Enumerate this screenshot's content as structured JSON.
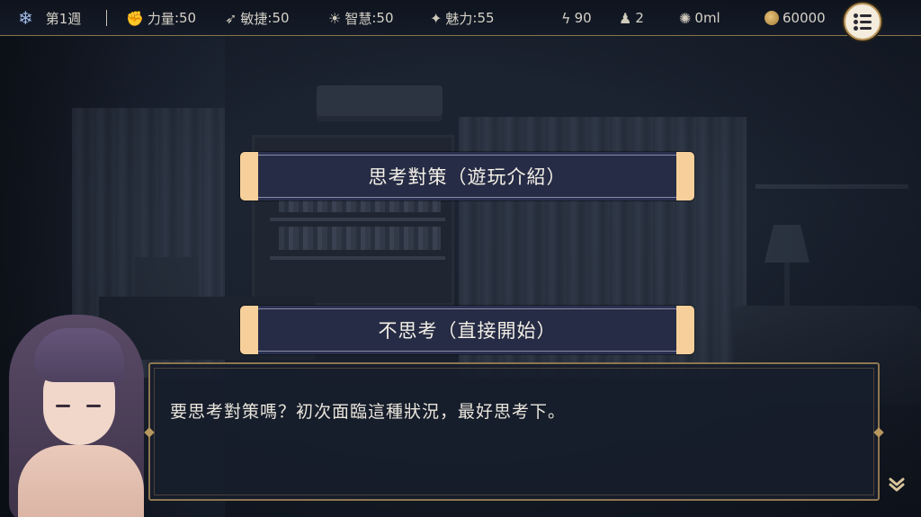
{
  "hud": {
    "week": "第1週",
    "stats": [
      {
        "name": "力量",
        "value": ":50",
        "icon": "fist-icon"
      },
      {
        "name": "敏捷",
        "value": ":50",
        "icon": "wing-icon"
      },
      {
        "name": "智慧",
        "value": ":50",
        "icon": "lightbulb-icon"
      },
      {
        "name": "魅力",
        "value": ":55",
        "icon": "sparkle-icon"
      }
    ],
    "energy": "90",
    "people": "2",
    "liquid": "0ml",
    "money": "60000"
  },
  "choices": [
    {
      "label": "思考對策（遊玩介紹）"
    },
    {
      "label": "不思考（直接開始）"
    }
  ],
  "dialog": {
    "text": "要思考對策嗎？初次面臨這種狀況，最好思考下。"
  },
  "colors": {
    "accent_gold": "#8d7650",
    "button_cap": "#f6cf9a",
    "button_body": "#2a3150"
  }
}
